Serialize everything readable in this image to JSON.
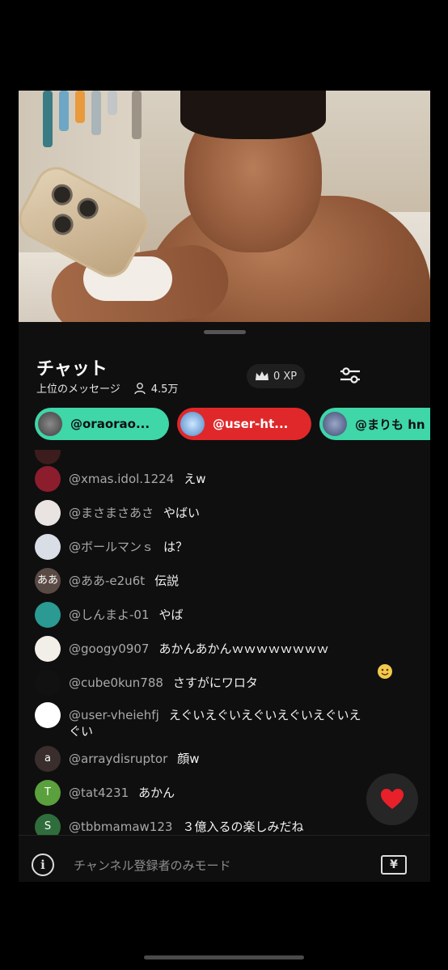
{
  "video": {
    "description_icon": "live-video-frame"
  },
  "chat": {
    "title": "チャット",
    "subtitle": "上位のメッセージ",
    "viewer_count": "4.5万",
    "xp_label": "0 XP",
    "filter_icon": "sliders-icon"
  },
  "chips": [
    {
      "label": "@oraorao...",
      "color": "#3fd6a8"
    },
    {
      "label": "@user-ht...",
      "color": "#e0282a"
    },
    {
      "label": "@まりも hn",
      "color": "#3fd6a8"
    }
  ],
  "messages": [
    {
      "user": "@xmas.idol.1224",
      "text": "えw",
      "avatar_color": "#8b1d2c",
      "avatar_text": ""
    },
    {
      "user": "@まさまさあさ",
      "text": "やばい",
      "avatar_color": "#e9e3e1",
      "avatar_text": ""
    },
    {
      "user": "@ボールマンｓ",
      "text": "は？",
      "avatar_color": "#d9dde6",
      "avatar_text": ""
    },
    {
      "user": "@ああ-e2u6t",
      "text": "伝説",
      "avatar_color": "#5a4a44",
      "avatar_text": "ああ"
    },
    {
      "user": "@しんまよ-01",
      "text": "やば",
      "avatar_color": "#2a9a92",
      "avatar_text": ""
    },
    {
      "user": "@googy0907",
      "text": "あかんあかんｗｗｗｗｗｗｗｗ",
      "avatar_color": "#f2efe8",
      "avatar_text": ""
    },
    {
      "user": "@cube0kun788",
      "text": "さすがにワロタ",
      "avatar_color": "#111111",
      "avatar_text": ""
    },
    {
      "user": "@user-vheiehfj",
      "text": "えぐいえぐいえぐいえぐいえぐいえ",
      "text2": "ぐい",
      "avatar_color": "#ffffff",
      "avatar_text": ""
    },
    {
      "user": "@arraydisruptor",
      "text": "顔w",
      "avatar_color": "#3a2e2c",
      "avatar_text": "a"
    },
    {
      "user": "@tat4231",
      "text": "あかん",
      "avatar_color": "#5aa03c",
      "avatar_text": "T"
    },
    {
      "user": "@tbbmamaw123",
      "text": "３億入るの楽しみだね",
      "avatar_color": "#2f6e3c",
      "avatar_text": "S"
    }
  ],
  "input": {
    "placeholder": "チャンネル登録者のみモード",
    "info_icon": "i",
    "yen_icon": "¥"
  },
  "colors": {
    "panel_bg": "#0f0f0f",
    "chip_green": "#3fd6a8",
    "chip_red": "#e0282a",
    "heart": "#e8202a"
  }
}
